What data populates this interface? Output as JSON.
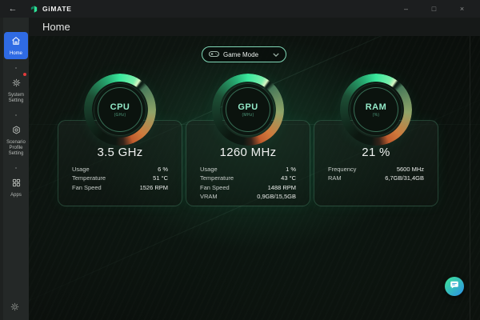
{
  "titlebar": {
    "app_name": "GiMATE",
    "back_glyph": "←",
    "minimize_glyph": "–",
    "maximize_glyph": "□",
    "close_glyph": "×"
  },
  "page": {
    "title": "Home"
  },
  "sidebar": {
    "items": [
      {
        "label": "Home",
        "icon": "home-icon",
        "active": true
      },
      {
        "label": "System Setting",
        "icon": "gear-icon",
        "badge": true
      },
      {
        "label": "Scenario Profile Setting",
        "icon": "scenario-gear-icon"
      },
      {
        "label": "Apps",
        "icon": "apps-grid-icon"
      }
    ],
    "footer_icon": "settings-gear-icon"
  },
  "mode_selector": {
    "label": "Game Mode",
    "icon": "gamepad-icon"
  },
  "gauges": [
    {
      "name": "CPU",
      "unit": "(GHz)",
      "value": "3.5 GHz",
      "rows": [
        {
          "label": "Usage",
          "value": "6 %"
        },
        {
          "label": "Temperature",
          "value": "51 °C"
        },
        {
          "label": "Fan Speed",
          "value": "1526 RPM"
        }
      ]
    },
    {
      "name": "GPU",
      "unit": "(MHz)",
      "value": "1260 MHz",
      "rows": [
        {
          "label": "Usage",
          "value": "1 %"
        },
        {
          "label": "Temperature",
          "value": "43 °C"
        },
        {
          "label": "Fan Speed",
          "value": "1488 RPM"
        },
        {
          "label": "VRAM",
          "value": "0,9GB/15,5GB"
        }
      ]
    },
    {
      "name": "RAM",
      "unit": "(%)",
      "value": "21 %",
      "rows": [
        {
          "label": "Frequency",
          "value": "5600 MHz"
        },
        {
          "label": "RAM",
          "value": "6,7GB/31,4GB"
        }
      ]
    }
  ],
  "chat_button": {
    "icon": "chat-bubble-icon"
  },
  "colors": {
    "accent_green": "#2ee398",
    "accent_blue": "#2f6be4",
    "gauge_orange": "#cf7a3c",
    "badge_red": "#e23b3b",
    "chat_gradient_start": "#3ee695",
    "chat_gradient_end": "#2b8fe8"
  }
}
